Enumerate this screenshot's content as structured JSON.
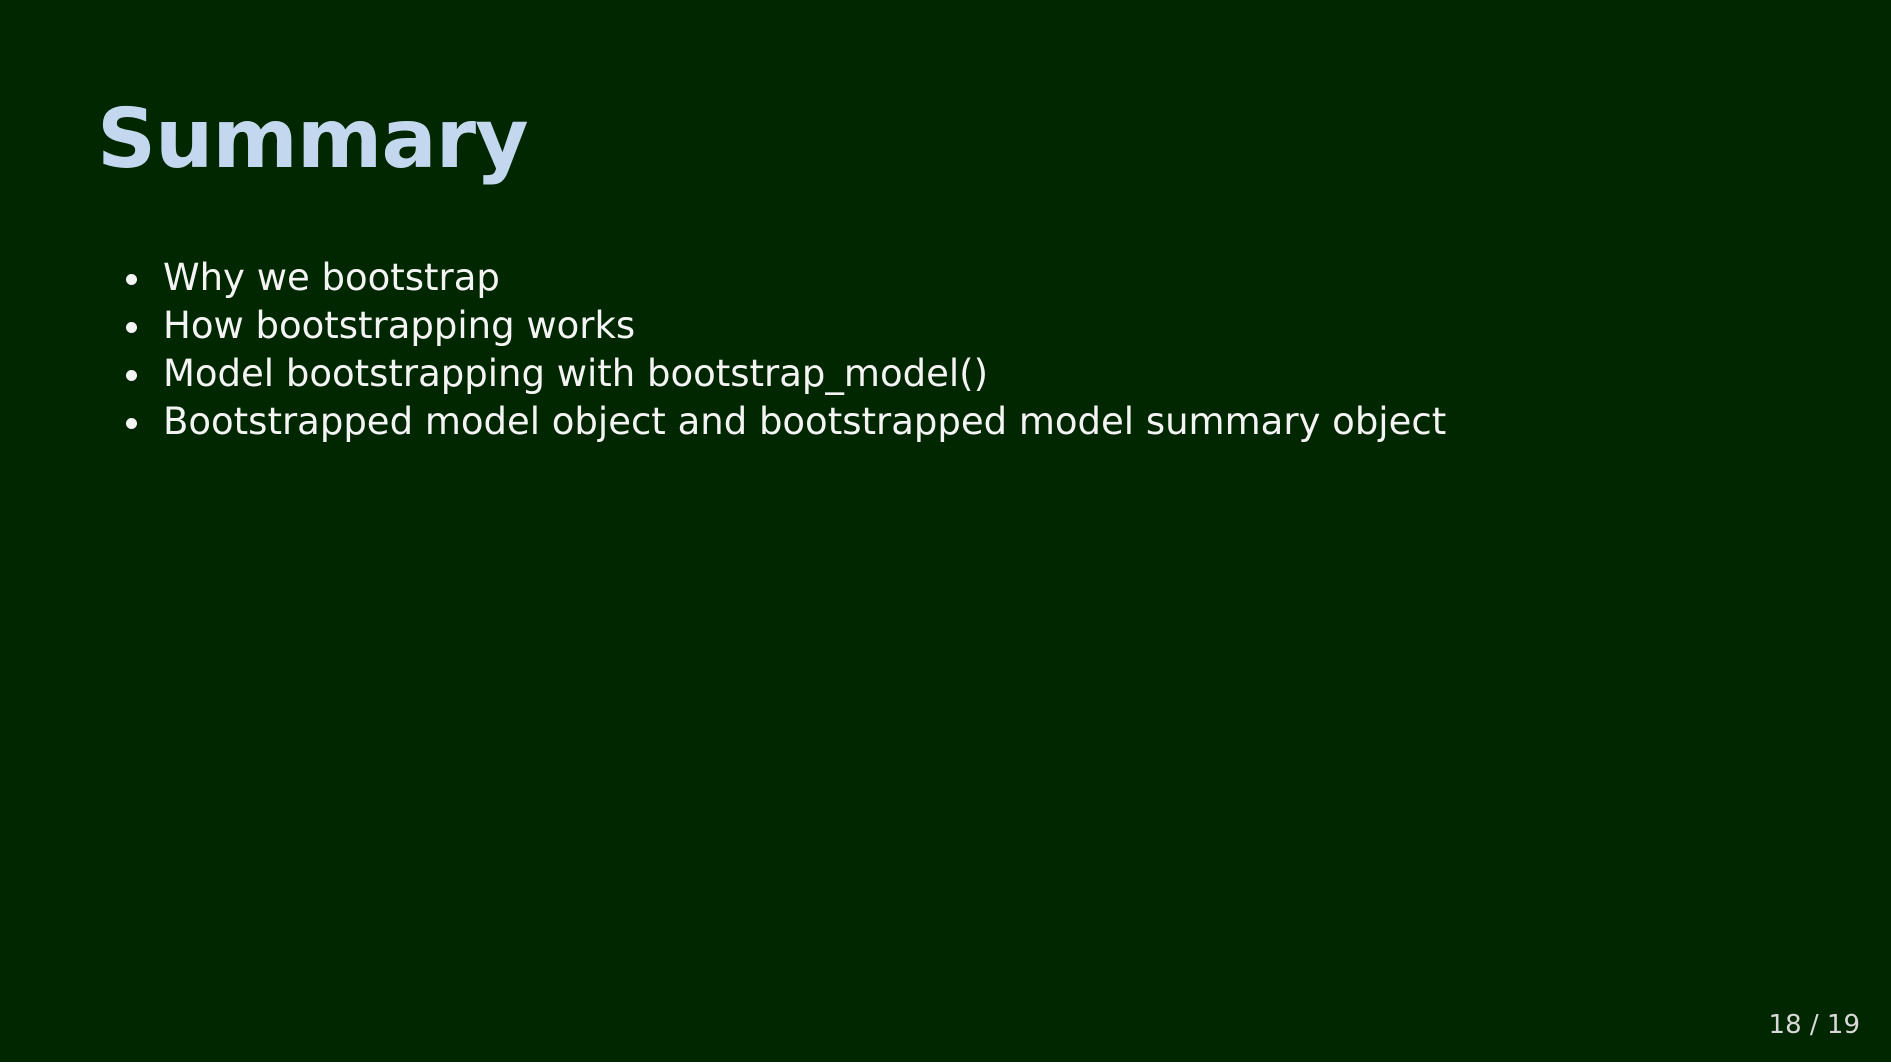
{
  "slide": {
    "title": "Summary",
    "bullets": [
      "Why we bootstrap",
      "How bootstrapping works",
      "Model bootstrapping with bootstrap_model()",
      "Bootstrapped model object and bootstrapped model summary object"
    ],
    "page_number": "18 / 19"
  },
  "colors": {
    "background": "#002700",
    "title": "#c3d8ee",
    "text": "#f4f4f4"
  }
}
